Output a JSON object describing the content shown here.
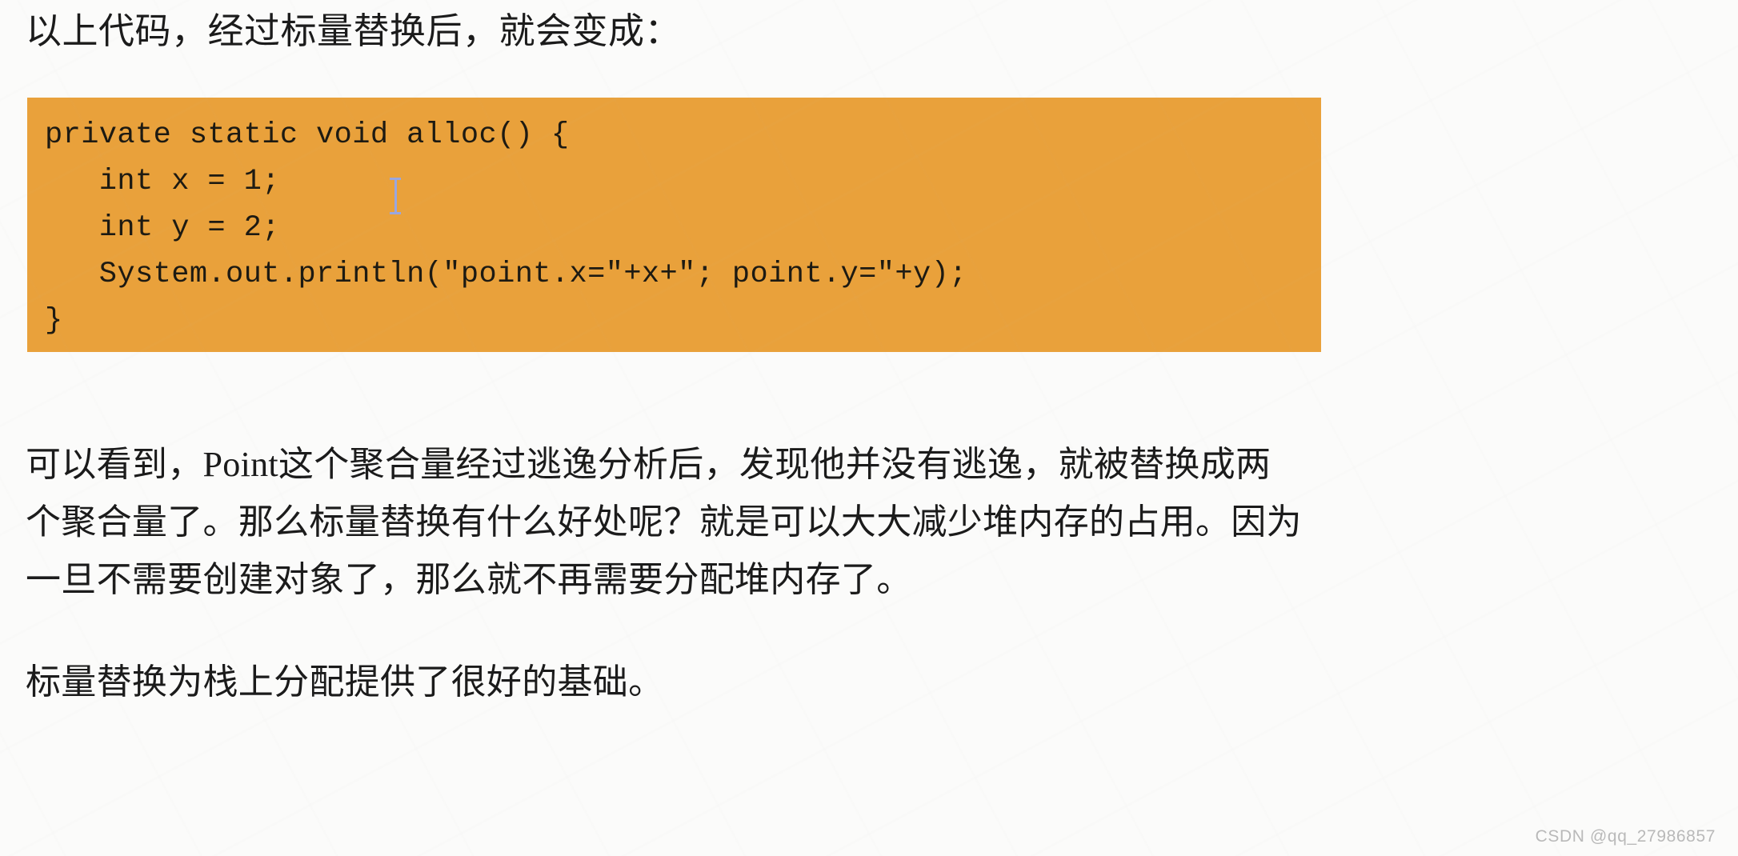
{
  "document": {
    "intro_line": "以上代码，经过标量替换后，就会变成：",
    "code_block": {
      "background_color": "#e9a13b",
      "language": "java",
      "lines": [
        "private static void alloc() {",
        "   int x = 1;",
        "   int y = 2;",
        "   System.out.println(\"point.x=\"+x+\"; point.y=\"+y);",
        "}"
      ]
    },
    "paragraphs": [
      {
        "lines": [
          "可以看到，Point这个聚合量经过逃逸分析后，发现他并没有逃逸，就被替换成两",
          "个聚合量了。那么标量替换有什么好处呢？就是可以大大减少堆内存的占用。因为",
          "一旦不需要创建对象了，那么就不再需要分配堆内存了。"
        ]
      },
      {
        "lines": [
          "标量替换为栈上分配提供了很好的基础。"
        ]
      }
    ],
    "cursor": {
      "type": "text-ibeam",
      "color": "#9aa7e0"
    },
    "watermark": {
      "text": "CSDN @qq_27986857",
      "color": "#b9b9b9"
    }
  }
}
